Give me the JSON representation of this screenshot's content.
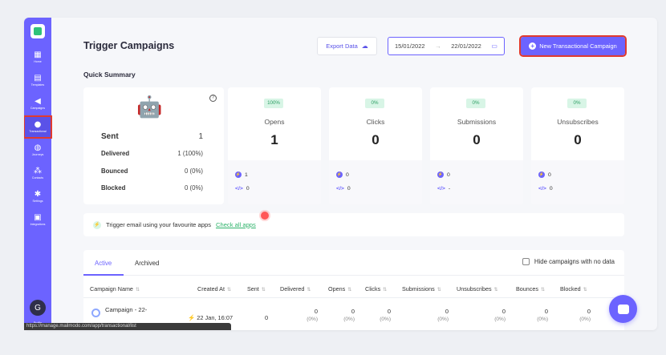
{
  "sidebar": {
    "items": [
      {
        "label": "Home",
        "icon": "grid-icon"
      },
      {
        "label": "Templates",
        "icon": "template-icon"
      },
      {
        "label": "Campaigns",
        "icon": "megaphone-icon"
      },
      {
        "label": "Transactional",
        "icon": "bolt-icon"
      },
      {
        "label": "Journeys",
        "icon": "journey-icon"
      },
      {
        "label": "Contacts",
        "icon": "contacts-icon"
      },
      {
        "label": "Settings",
        "icon": "gear-icon"
      },
      {
        "label": "Integrations",
        "icon": "integrations-icon"
      }
    ],
    "user_initial": "G",
    "user_label": "Profile"
  },
  "header": {
    "title": "Trigger Campaigns",
    "export_label": "Export Data",
    "date_from": "15/01/2022",
    "date_to": "22/01/2022",
    "date_sep": "→",
    "new_label": "New Transactional Campaign"
  },
  "summary": {
    "title": "Quick Summary",
    "sent_label": "Sent",
    "sent_value": "1",
    "delivered_label": "Delivered",
    "delivered_value": "1 (100%)",
    "bounced_label": "Bounced",
    "bounced_value": "0 (0%)",
    "blocked_label": "Blocked",
    "blocked_value": "0 (0%)",
    "stats": [
      {
        "pct": "100%",
        "name": "Opens",
        "value": "1",
        "api": "1",
        "code": "0"
      },
      {
        "pct": "0%",
        "name": "Clicks",
        "value": "0",
        "api": "0",
        "code": "0"
      },
      {
        "pct": "0%",
        "name": "Submissions",
        "value": "0",
        "api": "0",
        "code": "-"
      },
      {
        "pct": "0%",
        "name": "Unsubscribes",
        "value": "0",
        "api": "0",
        "code": "0"
      }
    ]
  },
  "trigger": {
    "text": "Trigger email using your favourite apps",
    "link": "Check all apps"
  },
  "table": {
    "tabs": [
      "Active",
      "Archived"
    ],
    "hide_label": "Hide campaigns with no data",
    "columns": [
      "Campaign Name",
      "Created At",
      "Sent",
      "Delivered",
      "Opens",
      "Clicks",
      "Submissions",
      "Unsubscribes",
      "Bounces",
      "Blocked"
    ],
    "row": {
      "name": "Campaign - 22-",
      "created": "22 Jan, 16:07",
      "sent": "0",
      "delivered": "0",
      "delivered_pct": "(0%)",
      "opens": "0",
      "opens_pct": "(0%)",
      "clicks": "0",
      "clicks_pct": "(0%)",
      "submissions": "0",
      "submissions_pct": "(0%)",
      "unsubscribes": "0",
      "unsubscribes_pct": "(0%)",
      "bounces": "0",
      "bounces_pct": "(0%)",
      "blocked": "0",
      "blocked_pct": "(0%)"
    }
  },
  "status_url": "https://manage.mailmodo.com/app/transactional/list",
  "colors": {
    "accent": "#6c63ff",
    "highlight": "#e03a2f",
    "success": "#2fb36b"
  }
}
